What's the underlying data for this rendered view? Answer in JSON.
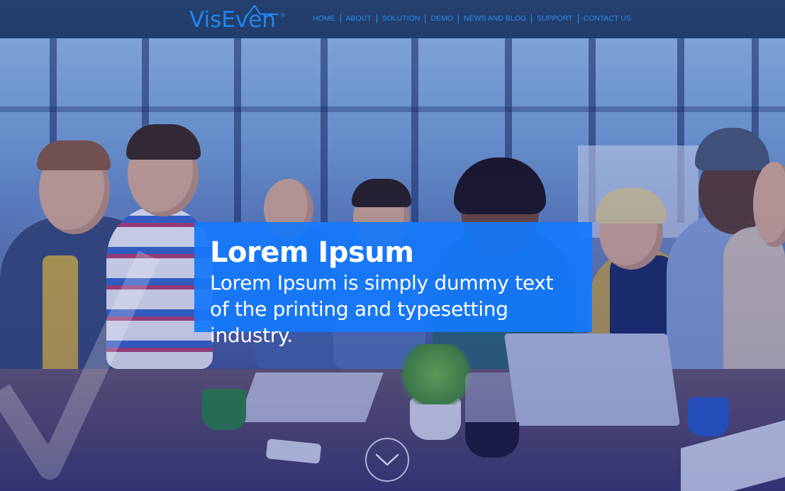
{
  "brand": {
    "logo_text": "VisEven",
    "registered_mark": "®",
    "color": "#1f86f0"
  },
  "nav": {
    "items": [
      {
        "label": "HOME"
      },
      {
        "label": "ABOUT"
      },
      {
        "label": "SOLUTION"
      },
      {
        "label": "DEMO"
      },
      {
        "label": "NEWS AND BLOG"
      },
      {
        "label": "SUPPORT"
      },
      {
        "label": "CONTACT US"
      }
    ],
    "link_color": "#2b8cf2"
  },
  "hero": {
    "title": "Lorem Ipsum",
    "text": "Lorem Ipsum is simply dummy text of the printing and typesetting industry.",
    "caption_color": "#1478fa",
    "scroll_icon": "chevron-down-icon"
  }
}
